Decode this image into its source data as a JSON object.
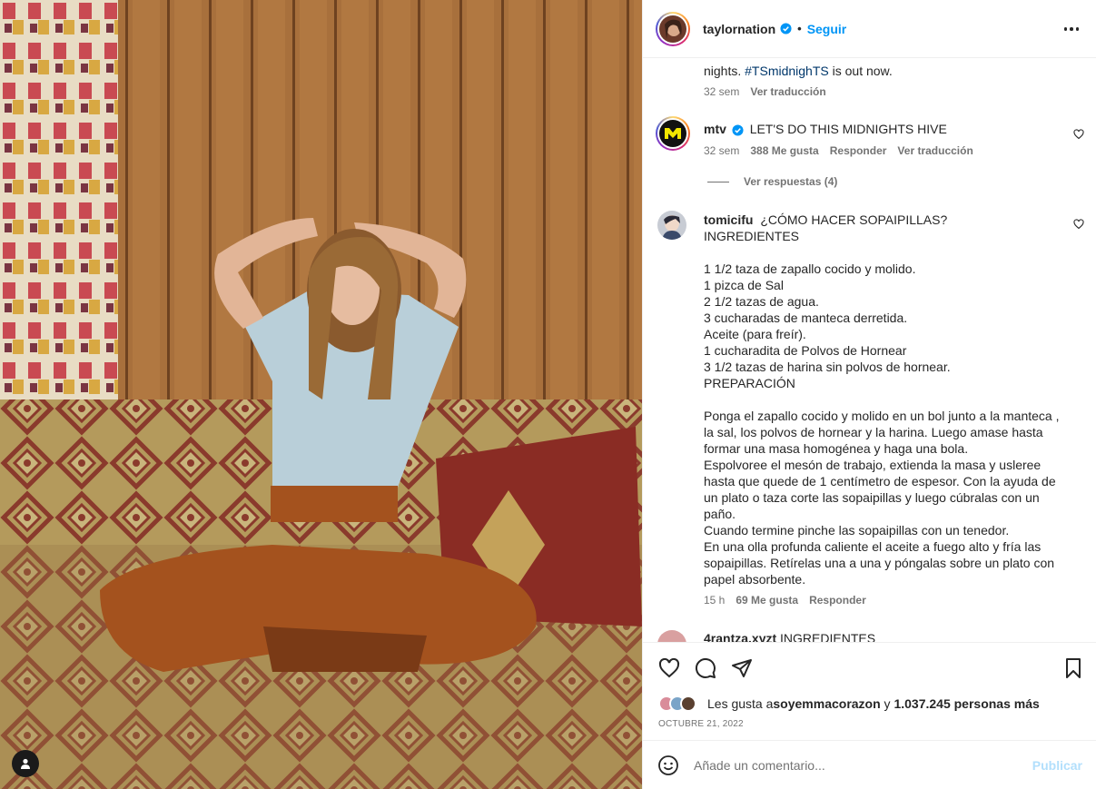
{
  "post": {
    "username": "taylornation",
    "follow_label": "Seguir",
    "separator": "•",
    "more_label": "more-options"
  },
  "caption": {
    "text_pre": "nights. ",
    "hashtag": "#TSmidnighTS",
    "text_post": " is out now.",
    "time": "32 sem",
    "translate": "Ver traducción"
  },
  "comments": [
    {
      "username": "mtv",
      "text": "LET'S DO THIS MIDNIGHTS HIVE",
      "time": "32 sem",
      "likes": "388 Me gusta",
      "reply": "Responder",
      "translate": "Ver traducción",
      "replies": "Ver respuestas (4)"
    },
    {
      "username": "tomicifu",
      "lines": [
        "¿CÓMO HACER SOPAIPILLAS?",
        "INGREDIENTES",
        "",
        "1 1/2 taza de zapallo cocido y molido.",
        "1 pizca de Sal",
        "2 1/2 tazas de agua.",
        "3 cucharadas de manteca derretida.",
        "Aceite (para freír).",
        "1 cucharadita de Polvos de Hornear",
        "3 1/2 tazas de harina sin polvos de hornear.",
        "PREPARACIÓN",
        "",
        "Ponga el zapallo cocido y molido en un bol junto a la manteca ,",
        "la sal, los polvos de hornear y la harina. Luego amase hasta",
        "formar una masa homogénea y haga una bola.",
        "Espolvoree el mesón de trabajo, extienda la masa y usleree",
        "hasta que quede de 1 centímetro de espesor. Con la ayuda de",
        "un plato o taza corte las sopaipillas y luego cúbralas con un",
        "paño.",
        "Cuando termine pinche las sopaipillas con un tenedor.",
        "En una olla profunda caliente el aceite a fuego alto y fría las",
        "sopaipillas. Retírelas una a una y póngalas sobre un plato con",
        "papel absorbente."
      ],
      "time": "15 h",
      "likes": "69 Me gusta",
      "reply": "Responder"
    },
    {
      "username": "4rantza.xyzt",
      "text": "INGREDIENTES"
    }
  ],
  "likes": {
    "prefix": "Les gusta a ",
    "user": "soyemmacorazon",
    "middle": " y ",
    "count": "1.037.245 personas más"
  },
  "date": "OCTUBRE 21, 2022",
  "add_comment": {
    "placeholder": "Añade un comentario...",
    "publish": "Publicar"
  },
  "colors": {
    "link": "#0095f6",
    "verified": "#0095f6",
    "publish_disabled": "#b2dffc"
  }
}
